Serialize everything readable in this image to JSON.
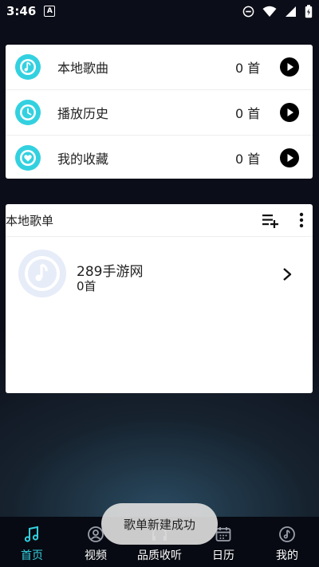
{
  "status_bar": {
    "time": "3:46",
    "notif_letter": "A"
  },
  "library": {
    "items": [
      {
        "label": "本地歌曲",
        "count": "0 首",
        "icon": "music-note-icon"
      },
      {
        "label": "播放历史",
        "count": "0 首",
        "icon": "clock-icon"
      },
      {
        "label": "我的收藏",
        "count": "0 首",
        "icon": "heart-icon"
      }
    ],
    "accent": "#33d1e0"
  },
  "playlist_section": {
    "title": "本地歌单",
    "items": [
      {
        "name": "289手游网",
        "count": "0首"
      }
    ]
  },
  "bottom_nav": {
    "items": [
      {
        "label": "首页",
        "icon": "music-note-icon",
        "active": true
      },
      {
        "label": "视频",
        "icon": "video-icon",
        "active": false
      },
      {
        "label": "品质收听",
        "icon": "headphones-icon",
        "active": false
      },
      {
        "label": "日历",
        "icon": "calendar-icon",
        "active": false
      },
      {
        "label": "我的",
        "icon": "profile-icon",
        "active": false
      }
    ]
  },
  "toast": {
    "message": "歌单新建成功"
  }
}
